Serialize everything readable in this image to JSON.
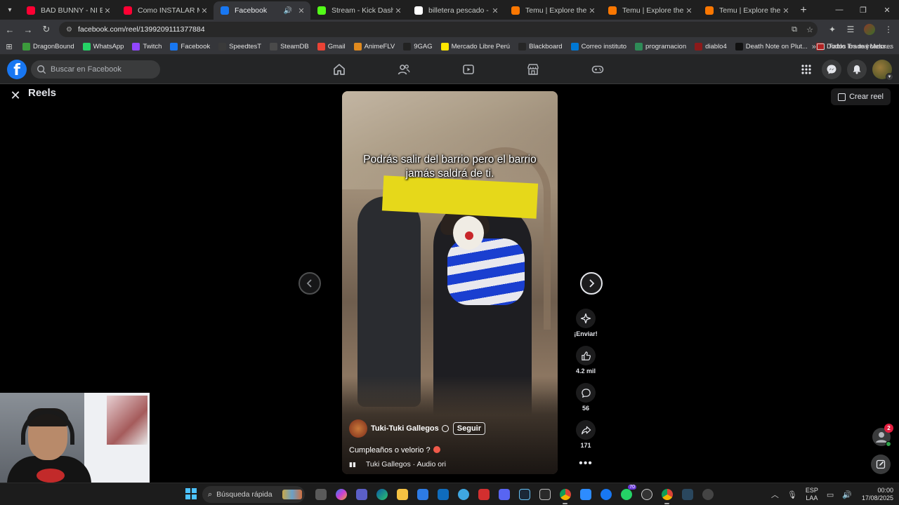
{
  "browser": {
    "tabs": [
      {
        "title": "BAD BUNNY - NI BIEN NI",
        "favicon": "youtube-icon",
        "color": "#ff0033",
        "active": false
      },
      {
        "title": "Como INSTALAR MODS e",
        "favicon": "youtube-icon",
        "color": "#ff0033",
        "active": false
      },
      {
        "title": "Facebook",
        "favicon": "facebook-icon",
        "color": "#1877f2",
        "active": true,
        "audio": true
      },
      {
        "title": "Stream - Kick Dashboard",
        "favicon": "kick-icon",
        "color": "#53fc18",
        "active": false
      },
      {
        "title": "billetera pescado - Buscar",
        "favicon": "google-icon",
        "color": "#ffffff",
        "active": false
      },
      {
        "title": "Temu | Explore the Latest",
        "favicon": "temu-icon",
        "color": "#fb7701",
        "active": false
      },
      {
        "title": "Temu | Explore the Latest",
        "favicon": "temu-icon",
        "color": "#fb7701",
        "active": false
      },
      {
        "title": "Temu | Explore the Latest",
        "favicon": "temu-icon",
        "color": "#fb7701",
        "active": false
      }
    ],
    "url": "facebook.com/reel/1399209111377884",
    "bookmarks": [
      {
        "label": "DragonBound",
        "color": "#3c9b3c"
      },
      {
        "label": "WhatsApp",
        "color": "#25d366"
      },
      {
        "label": "Twitch",
        "color": "#9146ff"
      },
      {
        "label": "Facebook",
        "color": "#1877f2"
      },
      {
        "label": "SpeedtesT",
        "color": "#3a3a3a"
      },
      {
        "label": "SteamDB",
        "color": "#4a4a4a"
      },
      {
        "label": "Gmail",
        "color": "#ea4335"
      },
      {
        "label": "AnimeFLV",
        "color": "#e08a1e"
      },
      {
        "label": "9GAG",
        "color": "#222222"
      },
      {
        "label": "Mercado Libre Perú",
        "color": "#ffe600"
      },
      {
        "label": "Blackboard",
        "color": "#262626"
      },
      {
        "label": "Correo instituto",
        "color": "#0078d4"
      },
      {
        "label": "programacion",
        "color": "#2e8b57"
      },
      {
        "label": "diablo4",
        "color": "#8b1a1a"
      },
      {
        "label": "Death Note on Plut...",
        "color": "#111111"
      },
      {
        "label": "Diablo Trade | Mess...",
        "color": "#b22222"
      }
    ],
    "all_bookmarks": "Todos los marcadores"
  },
  "facebook": {
    "search_placeholder": "Buscar en Facebook",
    "accent": "#1877f2"
  },
  "reels": {
    "title": "Reels",
    "create_label": "Crear reel",
    "caption": "Podrás salir del barrio pero el barrio jamás saldrá de ti.",
    "author": "Tuki-Tuki Gallegos",
    "follow_label": "Seguir",
    "description": "Cumpleaños o velorio ?",
    "audio": "Tuki Gallegos · Audio ori",
    "actions": {
      "send_label": "¡Enviar!",
      "likes": "4.2 mil",
      "comments": "56",
      "shares": "171"
    },
    "messenger_badge": "2"
  },
  "taskbar": {
    "search_placeholder": "Búsqueda rápida",
    "lang_line1": "ESP",
    "lang_line2": "LAA",
    "time": "00:00",
    "date": "17/08/2025",
    "badge_count": "70"
  }
}
